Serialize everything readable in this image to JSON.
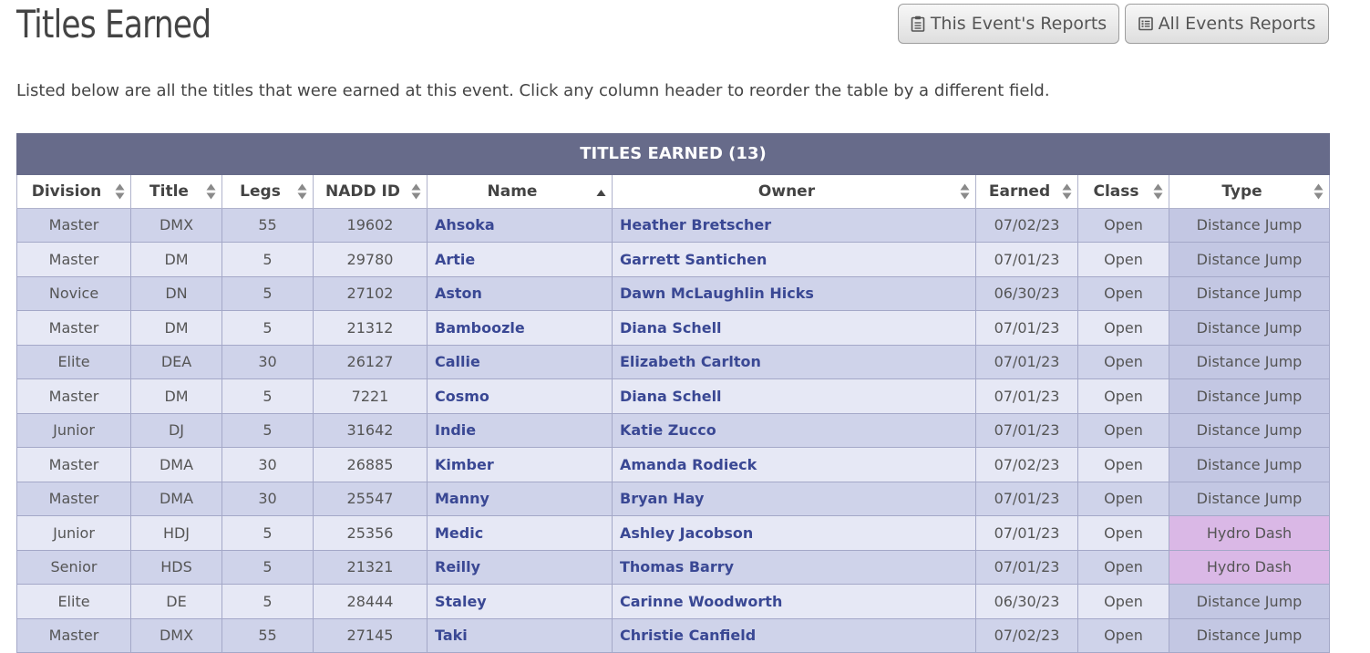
{
  "page": {
    "title": "Titles Earned",
    "intro": "Listed below are all the titles that were earned at this event. Click any column header to reorder the table by a different field."
  },
  "buttons": {
    "this_event": "This Event's Reports",
    "all_events": "All Events Reports"
  },
  "table": {
    "caption": "TITLES EARNED (13)",
    "columns": [
      "Division",
      "Title",
      "Legs",
      "NADD ID",
      "Name",
      "Owner",
      "Earned",
      "Class",
      "Type"
    ],
    "sorted_column": "Name",
    "rows": [
      [
        "Master",
        "DMX",
        "55",
        "19602",
        "Ahsoka",
        "Heather Bretscher",
        "07/02/23",
        "Open",
        "Distance Jump"
      ],
      [
        "Master",
        "DM",
        "5",
        "29780",
        "Artie",
        "Garrett Santichen",
        "07/01/23",
        "Open",
        "Distance Jump"
      ],
      [
        "Novice",
        "DN",
        "5",
        "27102",
        "Aston",
        "Dawn McLaughlin Hicks",
        "06/30/23",
        "Open",
        "Distance Jump"
      ],
      [
        "Master",
        "DM",
        "5",
        "21312",
        "Bamboozle",
        "Diana Schell",
        "07/01/23",
        "Open",
        "Distance Jump"
      ],
      [
        "Elite",
        "DEA",
        "30",
        "26127",
        "Callie",
        "Elizabeth Carlton",
        "07/01/23",
        "Open",
        "Distance Jump"
      ],
      [
        "Master",
        "DM",
        "5",
        "7221",
        "Cosmo",
        "Diana Schell",
        "07/01/23",
        "Open",
        "Distance Jump"
      ],
      [
        "Junior",
        "DJ",
        "5",
        "31642",
        "Indie",
        "Katie Zucco",
        "07/01/23",
        "Open",
        "Distance Jump"
      ],
      [
        "Master",
        "DMA",
        "30",
        "26885",
        "Kimber",
        "Amanda Rodieck",
        "07/02/23",
        "Open",
        "Distance Jump"
      ],
      [
        "Master",
        "DMA",
        "30",
        "25547",
        "Manny",
        "Bryan Hay",
        "07/01/23",
        "Open",
        "Distance Jump"
      ],
      [
        "Junior",
        "HDJ",
        "5",
        "25356",
        "Medic",
        "Ashley Jacobson",
        "07/01/23",
        "Open",
        "Hydro Dash"
      ],
      [
        "Senior",
        "HDS",
        "5",
        "21321",
        "Reilly",
        "Thomas Barry",
        "07/01/23",
        "Open",
        "Hydro Dash"
      ],
      [
        "Elite",
        "DE",
        "5",
        "28444",
        "Staley",
        "Carinne Woodworth",
        "06/30/23",
        "Open",
        "Distance Jump"
      ],
      [
        "Master",
        "DMX",
        "55",
        "27145",
        "Taki",
        "Christie Canfield",
        "07/02/23",
        "Open",
        "Distance Jump"
      ]
    ]
  },
  "colors": {
    "caption_bg": "#676b8a",
    "row_odd": "#cfd3ea",
    "row_even": "#e6e8f5",
    "link": "#3a4894",
    "hydro_dash": "#dab8e6"
  },
  "icons": {
    "this_event": "clipboard-icon",
    "all_events": "list-icon",
    "sort": "sort-arrows-icon",
    "sort_active": "sort-ascending-icon"
  }
}
